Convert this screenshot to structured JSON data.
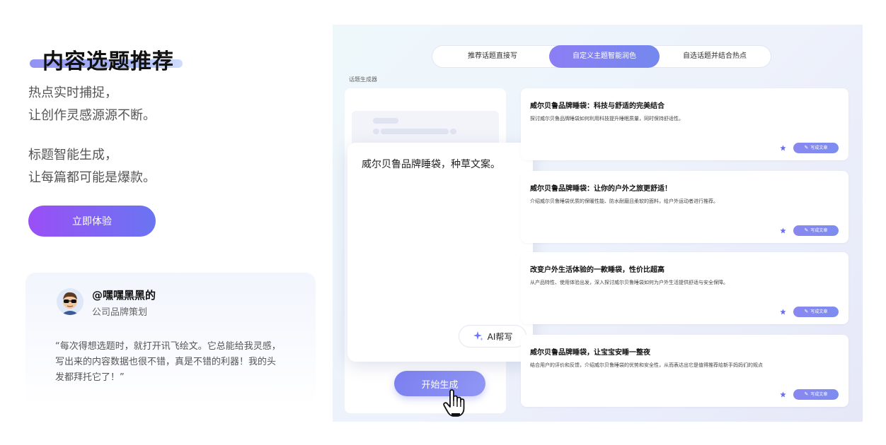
{
  "hero": {
    "title": "内容选题推荐",
    "desc1_line1": "热点实时捕捉，",
    "desc1_line2": "让创作灵感源源不断。",
    "desc2_line1": "标题智能生成，",
    "desc2_line2": "让每篇都可能是爆款。",
    "cta_label": "立即体验"
  },
  "testimonial": {
    "user_name": "@嘿嘿黑黑的",
    "user_role": "公司品牌策划",
    "quote": "“每次得想选题时，就打开讯飞绘文。它总能给我灵感，写出来的内容数据也很不错，真是不错的利器！我的头发都拜托它了！”"
  },
  "demo": {
    "tabs": [
      {
        "label": "推荐话题直接写",
        "active": false
      },
      {
        "label": "自定义主题智能润色",
        "active": true
      },
      {
        "label": "自选话题并结合热点",
        "active": false
      }
    ],
    "section_label": "话题生成器",
    "input_text": "威尔贝鲁品牌睡袋，种草文案。",
    "ai_button_label": "AI帮写",
    "generate_button_label": "开始生成",
    "write_button_label": "写成文章",
    "results": [
      {
        "title": "威尔贝鲁品牌睡袋：科技与舒适的完美结合",
        "desc": "探讨威尔贝鲁品牌睡袋如何利用科技提升睡眠质量，同时保持舒适性。"
      },
      {
        "title": "威尔贝鲁品牌睡袋：让你的户外之旅更舒适！",
        "desc": "介绍威尔贝鲁睡袋优质的保暖性能、防水耐磨且柔软的面料，给户外运动者进行推荐。"
      },
      {
        "title": "改变户外生活体验的一款睡袋，性价比超高",
        "desc": "从产品特性、使用体验出发，深入探讨威尔贝鲁睡袋如何为户外生活提供舒适与安全保障。"
      },
      {
        "title": "威尔贝鲁品牌睡袋，让宝宝安睡一整夜",
        "desc": "结合用户的评价和反馈，介绍威尔贝鲁睡袋的优势和安全性，从而表达出它是值得推荐给新手妈妈们的规点"
      }
    ]
  },
  "colors": {
    "accent_purple": "#9a4ff6",
    "accent_blue": "#6a75f2",
    "tab_active": "#8c7ef4",
    "panel_bg": "#eef2fb"
  },
  "icons": {
    "avatar": "avatar-cool-glasses",
    "sparkle": "sparkle-icon",
    "star": "star-icon",
    "pen": "pen-icon",
    "cursor": "hand-pointer-icon"
  }
}
